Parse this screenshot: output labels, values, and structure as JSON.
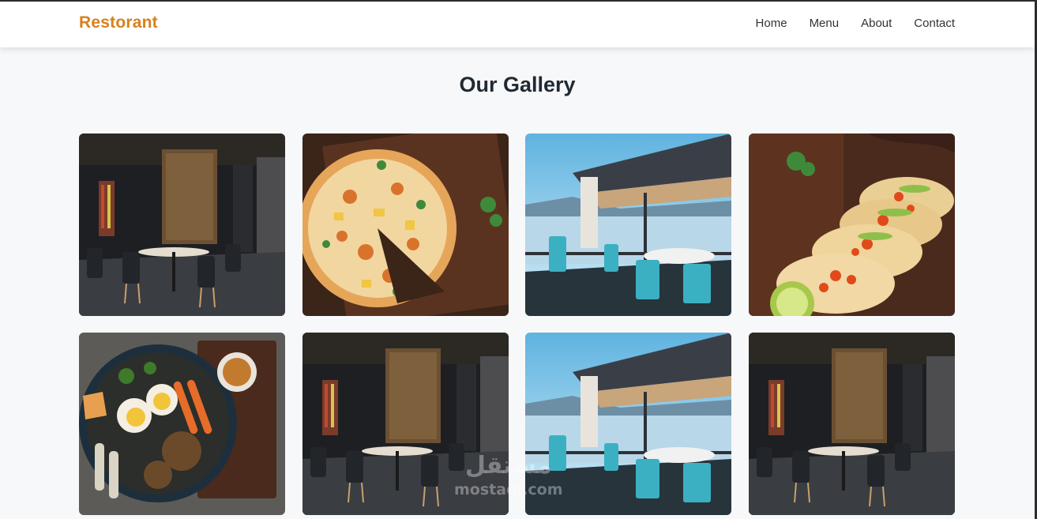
{
  "header": {
    "brand": "Restorant",
    "nav": [
      "Home",
      "Menu",
      "About",
      "Contact"
    ]
  },
  "gallery": {
    "title": "Our Gallery",
    "items": [
      {
        "subject": "restaurant-interior"
      },
      {
        "subject": "pizza"
      },
      {
        "subject": "seaside-terrace"
      },
      {
        "subject": "tacos"
      },
      {
        "subject": "noodle-bowl"
      },
      {
        "subject": "restaurant-interior"
      },
      {
        "subject": "seaside-terrace"
      },
      {
        "subject": "restaurant-interior"
      }
    ]
  },
  "watermark": {
    "arabic": "مستقل",
    "latin": "mostaql.com"
  },
  "colors": {
    "brand": "#d9801c",
    "background": "#f7f8fa",
    "title": "#1f2a33"
  }
}
